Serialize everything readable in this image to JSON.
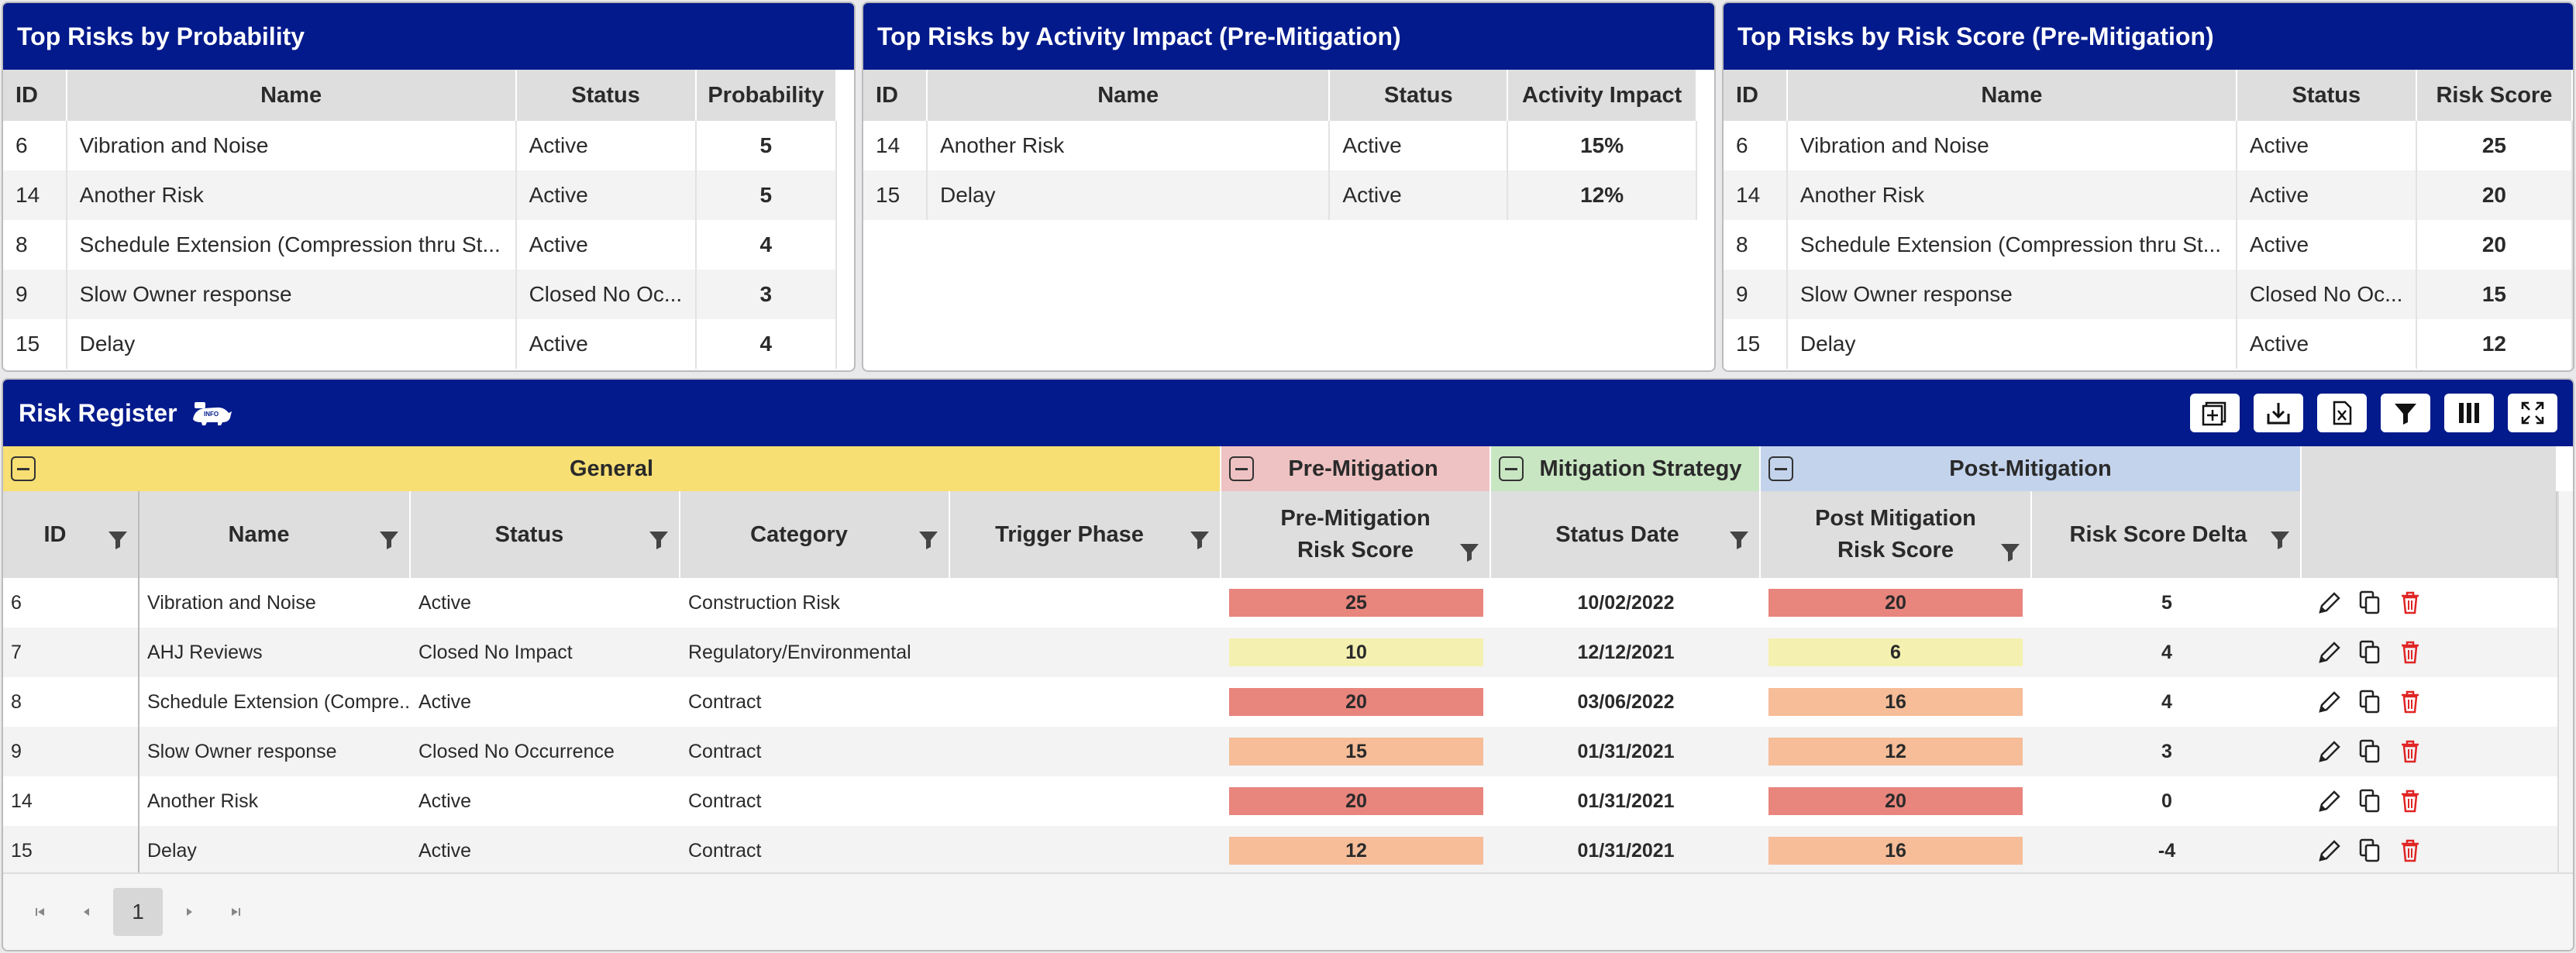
{
  "panels": {
    "probability": {
      "title": "Top Risks by Probability",
      "headers": [
        "ID",
        "Name",
        "Status",
        "Probability"
      ],
      "rows": [
        {
          "id": "6",
          "name": "Vibration and Noise",
          "status": "Active",
          "value": "5"
        },
        {
          "id": "14",
          "name": "Another Risk",
          "status": "Active",
          "value": "5"
        },
        {
          "id": "8",
          "name": "Schedule Extension (Compression thru St...",
          "status": "Active",
          "value": "4"
        },
        {
          "id": "9",
          "name": "Slow Owner response",
          "status": "Closed No Oc...",
          "value": "3"
        },
        {
          "id": "15",
          "name": "Delay",
          "status": "Active",
          "value": "4"
        }
      ]
    },
    "activity": {
      "title": "Top Risks by Activity Impact (Pre-Mitigation)",
      "headers": [
        "ID",
        "Name",
        "Status",
        "Activity Impact"
      ],
      "rows": [
        {
          "id": "14",
          "name": "Another Risk",
          "status": "Active",
          "value": "15%"
        },
        {
          "id": "15",
          "name": "Delay",
          "status": "Active",
          "value": "12%"
        }
      ]
    },
    "riskscore": {
      "title": "Top Risks by Risk Score (Pre-Mitigation)",
      "headers": [
        "ID",
        "Name",
        "Status",
        "Risk Score"
      ],
      "rows": [
        {
          "id": "6",
          "name": "Vibration and Noise",
          "status": "Active",
          "value": "25"
        },
        {
          "id": "14",
          "name": "Another Risk",
          "status": "Active",
          "value": "20"
        },
        {
          "id": "8",
          "name": "Schedule Extension (Compression thru St...",
          "status": "Active",
          "value": "20"
        },
        {
          "id": "9",
          "name": "Slow Owner response",
          "status": "Closed No Oc...",
          "value": "15"
        },
        {
          "id": "15",
          "name": "Delay",
          "status": "Active",
          "value": "12"
        }
      ]
    }
  },
  "register": {
    "title": "Risk Register",
    "info_icon": "rhino-info-icon",
    "toolbar": [
      "add-row-icon",
      "export-icon",
      "excel-icon",
      "filter-icon",
      "columns-icon",
      "fullscreen-icon"
    ],
    "groups": {
      "general": "General",
      "pre": "Pre-Mitigation",
      "strategy": "Mitigation Strategy",
      "post": "Post-Mitigation"
    },
    "headers": {
      "id": "ID",
      "name": "Name",
      "status": "Status",
      "category": "Category",
      "trigger": "Trigger Phase",
      "pre_score": "Pre-Mitigation Risk Score",
      "status_date": "Status Date",
      "post_score": "Post Mitigation Risk Score",
      "delta": "Risk Score Delta"
    },
    "rows": [
      {
        "id": "6",
        "name": "Vibration and Noise",
        "status": "Active",
        "category": "Construction Risk",
        "trigger": "",
        "pre": "25",
        "pre_level": "high",
        "date": "10/02/2022",
        "post": "20",
        "post_level": "high",
        "delta": "5"
      },
      {
        "id": "7",
        "name": "AHJ Reviews",
        "status": "Closed No Impact",
        "category": "Regulatory/Environmental",
        "trigger": "",
        "pre": "10",
        "pre_level": "low",
        "date": "12/12/2021",
        "post": "6",
        "post_level": "low",
        "delta": "4"
      },
      {
        "id": "8",
        "name": "Schedule Extension (Compre...",
        "status": "Active",
        "category": "Contract",
        "trigger": "",
        "pre": "20",
        "pre_level": "high",
        "date": "03/06/2022",
        "post": "16",
        "post_level": "medium",
        "delta": "4"
      },
      {
        "id": "9",
        "name": "Slow Owner response",
        "status": "Closed No Occurrence",
        "category": "Contract",
        "trigger": "",
        "pre": "15",
        "pre_level": "medium",
        "date": "01/31/2021",
        "post": "12",
        "post_level": "medium",
        "delta": "3"
      },
      {
        "id": "14",
        "name": "Another Risk",
        "status": "Active",
        "category": "Contract",
        "trigger": "",
        "pre": "20",
        "pre_level": "high",
        "date": "01/31/2021",
        "post": "20",
        "post_level": "high",
        "delta": "0"
      },
      {
        "id": "15",
        "name": "Delay",
        "status": "Active",
        "category": "Contract",
        "trigger": "",
        "pre": "12",
        "pre_level": "medium",
        "date": "01/31/2021",
        "post": "16",
        "post_level": "medium",
        "delta": "-4"
      }
    ],
    "pager": {
      "current": "1"
    }
  },
  "colors": {
    "header_blue": "#021a8c",
    "general": "#f7df74",
    "pre": "#eec2c2",
    "strategy": "#c8e6c2",
    "post": "#c3d3ec",
    "high": "#e8857d",
    "medium": "#f6bd98",
    "low": "#f4f0b0"
  }
}
